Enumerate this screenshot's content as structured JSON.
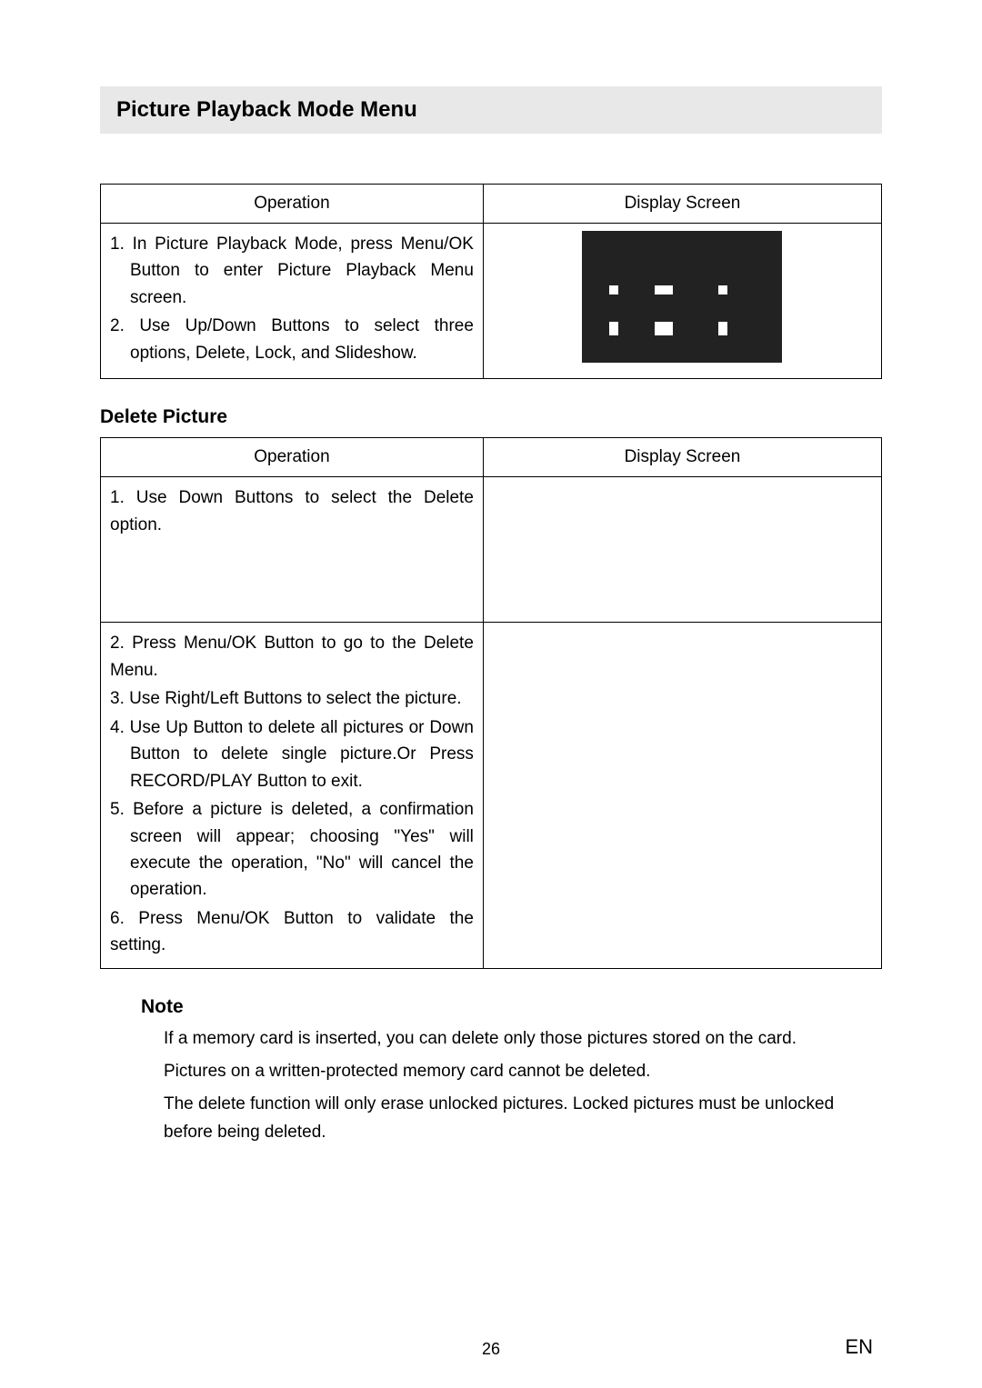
{
  "title": "Picture Playback Mode Menu",
  "table1": {
    "header_op": "Operation",
    "header_ds": "Display Screen",
    "row1_op1": "1. In Picture Playback Mode, press Menu/OK Button to enter Picture Playback Menu screen.",
    "row1_op2": "2. Use Up/Down Buttons to select three options, Delete, Lock, and Slideshow."
  },
  "section_delete": "Delete Picture",
  "table2": {
    "header_op": "Operation",
    "header_ds": "Display Screen",
    "row1_op1": "1. Use Down Buttons to select the Delete option.",
    "row2_op1": "2. Press Menu/OK Button to go to the Delete Menu.",
    "row2_op2": "3. Use Right/Left Buttons to select the picture.",
    "row2_op3": "4. Use Up Button to delete all pictures or Down Button to delete single picture.Or Press RECORD/PLAY Button to exit.",
    "row2_op4": "5. Before a picture is deleted, a confirmation screen will appear; choosing \"Yes\" will execute the operation, \"No\" will cancel the operation.",
    "row2_op5": "6. Press Menu/OK Button to validate the setting."
  },
  "note_label": "Note",
  "notes": {
    "n1": "If a memory card is inserted, you can delete only those pictures stored on the card.",
    "n2": "Pictures on a written-protected memory card cannot be deleted.",
    "n3": "The delete function will only erase unlocked pictures. Locked pictures must be unlocked before being deleted."
  },
  "page_number": "26",
  "lang": "EN"
}
